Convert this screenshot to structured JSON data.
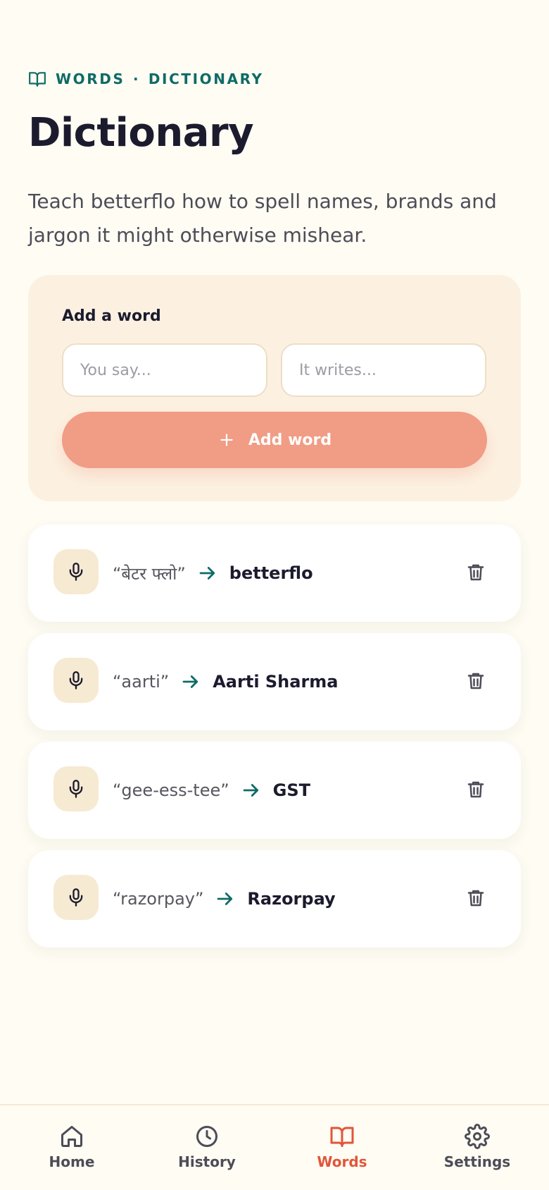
{
  "header": {
    "eyebrow_section": "WORDS",
    "eyebrow_separator": "·",
    "eyebrow_page": "DICTIONARY",
    "title": "Dictionary",
    "subtitle": "Teach betterflo how to spell names, brands and jargon it might otherwise mishear."
  },
  "add_form": {
    "label": "Add a word",
    "say_placeholder": "You say...",
    "writes_placeholder": "It writes...",
    "button_label": "Add word"
  },
  "words": [
    {
      "spoken": "“बेटर फ्लो”",
      "written": "betterflo"
    },
    {
      "spoken": "“aarti”",
      "written": "Aarti Sharma"
    },
    {
      "spoken": "“gee-ess-tee”",
      "written": "GST"
    },
    {
      "spoken": "“razorpay”",
      "written": "Razorpay"
    }
  ],
  "nav": {
    "home": "Home",
    "history": "History",
    "words": "Words",
    "settings": "Settings",
    "active": "words"
  },
  "colors": {
    "background": "#fefcf3",
    "accent": "#0f6b66",
    "primary_button": "#f19c85",
    "active_nav": "#e2553a",
    "card": "#fcf1e1"
  },
  "icons": {
    "eyebrow": "book-open-icon",
    "add": "plus-icon",
    "row_badge": "microphone-icon",
    "mapping": "arrow-right-icon",
    "row_action": "trash-icon",
    "nav_home": "home-icon",
    "nav_history": "clock-icon",
    "nav_words": "book-open-icon",
    "nav_settings": "gear-icon"
  }
}
